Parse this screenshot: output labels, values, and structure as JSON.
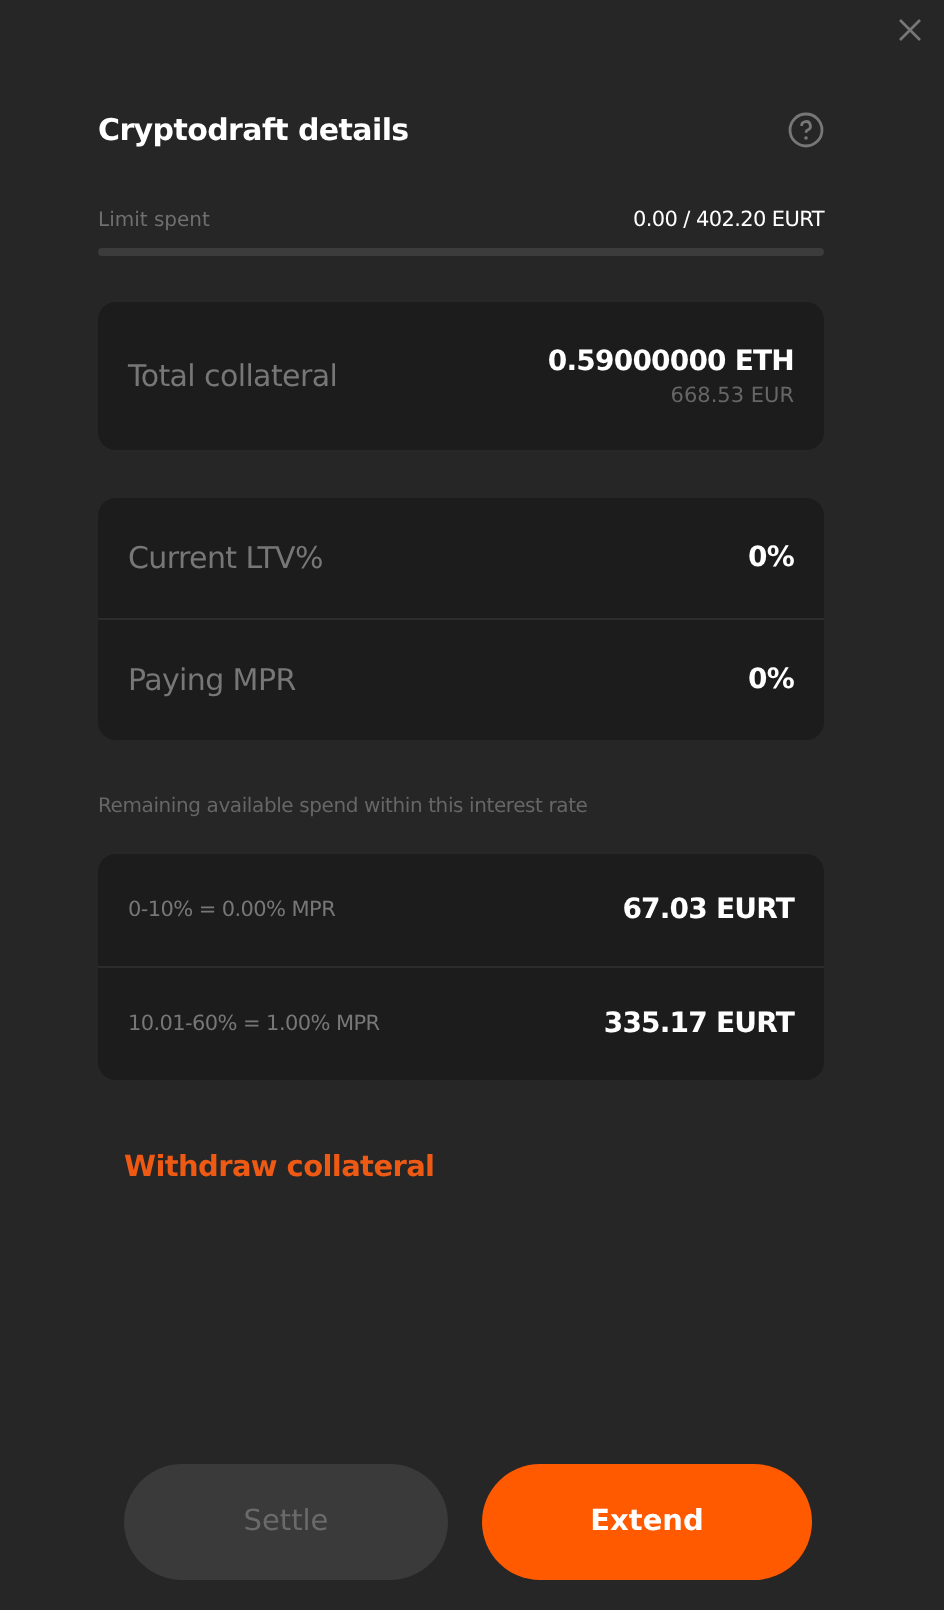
{
  "title": "Cryptodraft details",
  "limit": {
    "label": "Limit spent",
    "value": "0.00 / 402.20 EURT",
    "level": 0
  },
  "collateral": {
    "label": "Total collateral",
    "value": "0.59000000 ETH",
    "sub": "668.53 EUR"
  },
  "stats": [
    {
      "label": "Current LTV%",
      "value": "0%"
    },
    {
      "label": "Paying MPR",
      "value": "0%"
    }
  ],
  "tiers_note": "Remaining available spend within this interest rate",
  "tiers": [
    {
      "label": "0-10% = 0.00% MPR",
      "value": "67.03 EURT"
    },
    {
      "label": "10.01-60% = 1.00% MPR",
      "value": "335.17 EURT"
    }
  ],
  "withdraw_link": "Withdraw collateral",
  "buttons": [
    {
      "label": "Settle",
      "kind": "secondary",
      "disabled": true
    },
    {
      "label": "Extend",
      "kind": "primary",
      "disabled": false
    }
  ]
}
